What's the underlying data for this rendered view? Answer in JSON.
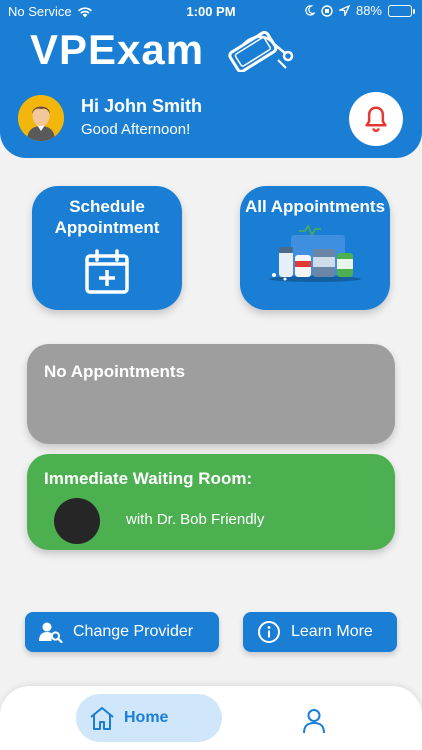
{
  "status_bar": {
    "carrier": "No Service",
    "time": "1:00 PM",
    "battery": "88%",
    "battery_level": 0.88
  },
  "header": {
    "app_title": "VPExam",
    "greeting_name": "Hi John Smith",
    "greeting_sub": "Good Afternoon!"
  },
  "tiles": {
    "schedule_label": "Schedule Appointment",
    "all_label": "All Appointments"
  },
  "appointments_card": {
    "title": "No Appointments"
  },
  "waiting_card": {
    "title": "Immediate Waiting Room:",
    "doctor_text": "with Dr. Bob Friendly"
  },
  "actions": {
    "change_provider": "Change Provider",
    "learn_more": "Learn More"
  },
  "nav": {
    "home_label": "Home"
  },
  "colors": {
    "primary": "#1a7fd4",
    "green": "#4caf50",
    "gray": "#9e9e9e",
    "bell": "#e53935"
  }
}
